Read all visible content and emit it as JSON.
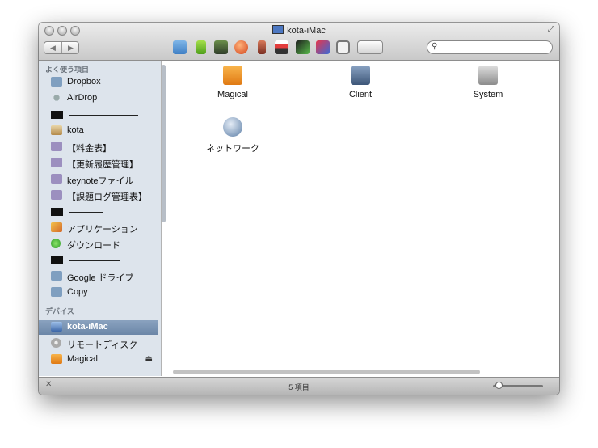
{
  "window": {
    "title": "kota-iMac"
  },
  "toolbar": {
    "back_label": "◀",
    "forward_label": "▶",
    "search_placeholder": "",
    "icons": [
      "photo-icon",
      "green-bar-icon",
      "printer-icon",
      "ball-icon",
      "person-icon",
      "sushi-icon",
      "screen-icon",
      "wand-icon",
      "square-button-icon",
      "pill-button-icon"
    ]
  },
  "sidebar": {
    "favorites_heading": "よく使う項目",
    "items": [
      {
        "label": "Dropbox"
      },
      {
        "label": "AirDrop"
      },
      {
        "label": ""
      },
      {
        "label": "kota"
      },
      {
        "label": "【料金表】"
      },
      {
        "label": "【更新履歴管理】"
      },
      {
        "label": "keynoteファイル"
      },
      {
        "label": "【課題ログ管理表】"
      },
      {
        "label": ""
      },
      {
        "label": "アプリケーション"
      },
      {
        "label": "ダウンロード"
      },
      {
        "label": ""
      },
      {
        "label": "Google ドライブ"
      },
      {
        "label": "Copy"
      }
    ],
    "devices_heading": "デバイス",
    "devices": [
      {
        "label": "kota-iMac",
        "selected": true
      },
      {
        "label": "リモートディスク"
      },
      {
        "label": "Magical",
        "eject": "⏏"
      }
    ]
  },
  "content": {
    "files": [
      {
        "label": "Magical",
        "icon": "orange-drive-icon"
      },
      {
        "label": "Client",
        "icon": "network-share-icon"
      },
      {
        "label": "System",
        "icon": "hard-disk-icon"
      },
      {
        "label": "ネットワーク",
        "icon": "globe-icon"
      }
    ]
  },
  "status": {
    "text": "5 項目"
  },
  "colors": {
    "selection": "#6b86a7",
    "sidebar_bg": "#dde4ec"
  }
}
